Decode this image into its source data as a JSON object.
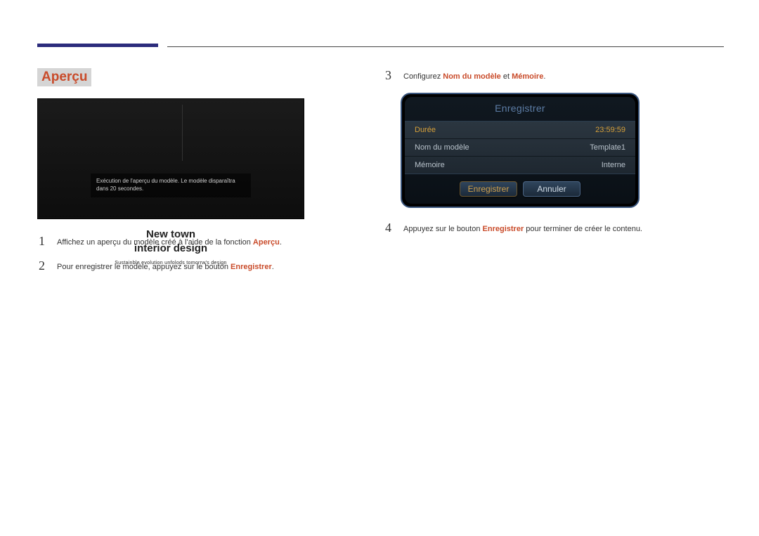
{
  "section_title": "Aperçu",
  "preview": {
    "message": "Exécution de l'aperçu du modèle. Le modèle disparaîtra dans 20 secondes.",
    "caption_line1": "New town",
    "caption_line2": "interior design",
    "caption_sub": "Sustainble evolution unfolods tomorrw's design"
  },
  "steps_left": [
    {
      "num": "1",
      "parts": [
        {
          "t": "Affichez un aperçu du modèle créé à l'aide de la fonction "
        },
        {
          "t": "Aperçu",
          "hl": true
        },
        {
          "t": "."
        }
      ]
    },
    {
      "num": "2",
      "parts": [
        {
          "t": "Pour enregistrer le modèle, appuyez sur le bouton "
        },
        {
          "t": "Enregistrer",
          "hl": true
        },
        {
          "t": "."
        }
      ]
    }
  ],
  "steps_right": [
    {
      "num": "3",
      "parts": [
        {
          "t": "Configurez "
        },
        {
          "t": "Nom du modèle",
          "hl": true
        },
        {
          "t": " et "
        },
        {
          "t": "Mémoire",
          "hl": true
        },
        {
          "t": "."
        }
      ]
    },
    {
      "num": "4",
      "parts": [
        {
          "t": "Appuyez sur le bouton "
        },
        {
          "t": "Enregistrer",
          "hl": true
        },
        {
          "t": " pour terminer de créer le contenu."
        }
      ]
    }
  ],
  "panel": {
    "title": "Enregistrer",
    "rows": [
      {
        "label": "Durée",
        "value": "23:59:59",
        "selected": true
      },
      {
        "label": "Nom du modèle",
        "value": "Template1",
        "selected": false
      },
      {
        "label": "Mémoire",
        "value": "Interne",
        "selected": false
      }
    ],
    "buttons": {
      "register": "Enregistrer",
      "cancel": "Annuler"
    }
  }
}
